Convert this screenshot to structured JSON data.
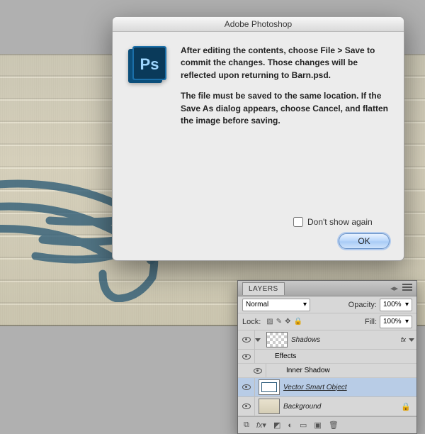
{
  "dialog": {
    "title": "Adobe Photoshop",
    "p1": "After editing the contents, choose File > Save to commit the changes.  Those changes will be reflected upon returning to Barn.psd.",
    "p2": "The file must be saved to the same location. If the Save As dialog appears, choose Cancel, and flatten the image before saving.",
    "dont_show": "Don't show again",
    "ok": "OK"
  },
  "layers": {
    "tab": "LAYERS",
    "blend_mode": "Normal",
    "opacity_label": "Opacity:",
    "opacity_value": "100%",
    "lock_label": "Lock:",
    "fill_label": "Fill:",
    "fill_value": "100%",
    "items": [
      {
        "name": "Shadows",
        "fx": "fx"
      },
      {
        "effects": "Effects"
      },
      {
        "effect": "Inner Shadow"
      },
      {
        "name": "Vector Smart Object"
      },
      {
        "name": "Background"
      }
    ],
    "footer_link": "⟲"
  }
}
